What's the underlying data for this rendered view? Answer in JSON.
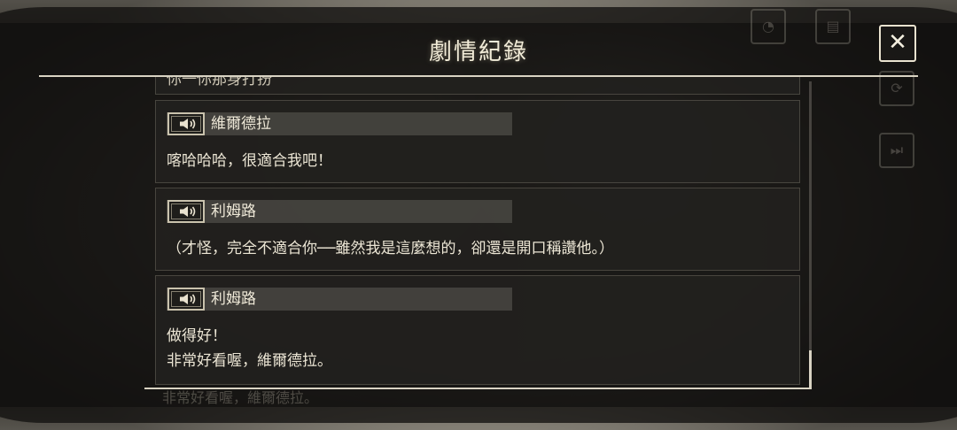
{
  "header": {
    "title": "劇情紀錄",
    "close_label": "✕"
  },
  "log": {
    "partial_text": "你一你那身打扮",
    "entries": [
      {
        "speaker": "維爾德拉",
        "lines": [
          "喀哈哈哈，很適合我吧！"
        ]
      },
      {
        "speaker": "利姆路",
        "lines": [
          "（才怪，完全不適合你──雖然我是這麼想的，卻還是開口稱讚他。）"
        ]
      },
      {
        "speaker": "利姆路",
        "lines": [
          "做得好！",
          "非常好看喔，維爾德拉。"
        ]
      }
    ]
  },
  "background": {
    "under_text": "非常好看喔，維爾德拉。"
  },
  "icons": {
    "voice": "speaker-voice-icon",
    "close": "close-icon"
  },
  "colors": {
    "panel": "#22211e",
    "name_bar": "#55534d",
    "text": "#ebe5d4",
    "frame_line": "#d9d3c3"
  }
}
